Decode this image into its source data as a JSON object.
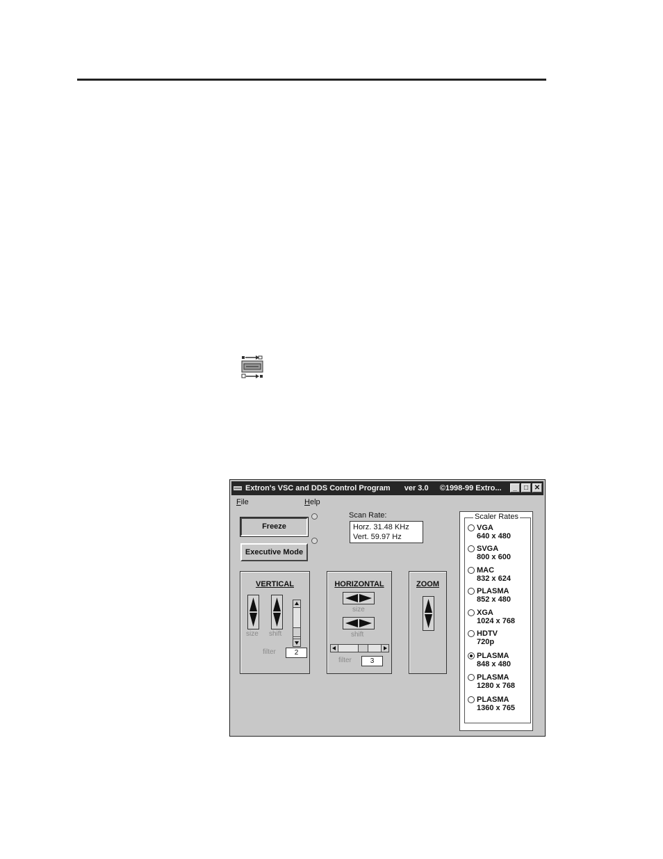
{
  "window": {
    "title": "Extron's VSC and DDS Control Program",
    "version": "ver 3.0",
    "copyright": "©1998-99 Extro...",
    "controls": {
      "minimize": "_",
      "maximize": "□",
      "close": "✕"
    }
  },
  "menu": {
    "file": {
      "key": "F",
      "rest": "ile"
    },
    "help": {
      "key": "H",
      "rest": "elp"
    }
  },
  "buttons": {
    "freeze": "Freeze",
    "executive_mode": "Executive Mode"
  },
  "scan_rate": {
    "label": "Scan Rate:",
    "horz": "Horz. 31.48 KHz",
    "vert": "Vert. 59.97 Hz"
  },
  "vertical": {
    "title": "VERTICAL",
    "size_label": "size",
    "shift_label": "shift",
    "filter_label": "filter",
    "filter_value": "2"
  },
  "horizontal": {
    "title": "HORIZONTAL",
    "size_label": "size",
    "shift_label": "shift",
    "filter_label": "filter",
    "filter_value": "3"
  },
  "zoom": {
    "title": "ZOOM"
  },
  "scaler_rates": {
    "legend": "Scaler Rates",
    "items": [
      {
        "name": "VGA",
        "res": "640 x 480",
        "selected": false
      },
      {
        "name": "SVGA",
        "res": "800 x 600",
        "selected": false
      },
      {
        "name": "MAC",
        "res": "832 x 624",
        "selected": false
      },
      {
        "name": "PLASMA",
        "res": "852 x 480",
        "selected": false
      },
      {
        "name": "XGA",
        "res": "1024 x 768",
        "selected": false
      },
      {
        "name": "HDTV",
        "res": "720p",
        "selected": false
      },
      {
        "name": "PLASMA",
        "res": "848 x 480",
        "selected": true
      },
      {
        "name": "PLASMA",
        "res": "1280 x 768",
        "selected": false
      },
      {
        "name": "PLASMA",
        "res": "1360 x 765",
        "selected": false
      }
    ]
  }
}
